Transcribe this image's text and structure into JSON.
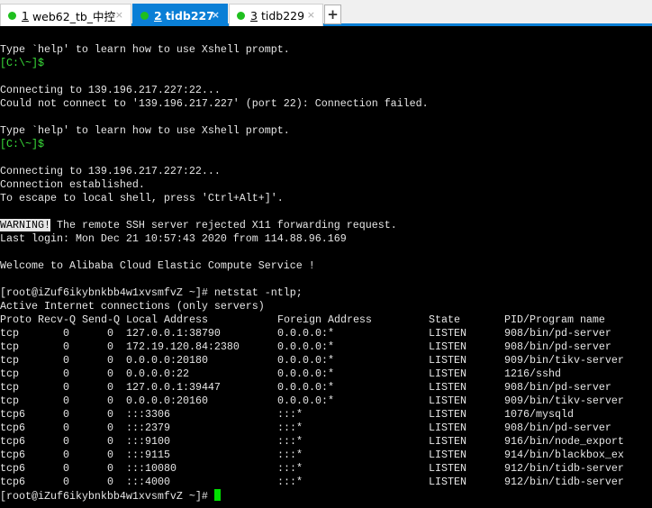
{
  "tabs": [
    {
      "num": "1",
      "label": "web62_tb_中控",
      "close": "×"
    },
    {
      "num": "2",
      "label": "tidb227",
      "close": "×"
    },
    {
      "num": "3",
      "label": "tidb229",
      "close": "×"
    }
  ],
  "new_tab": "+",
  "terminal": {
    "help1": "Type `help' to learn how to use Xshell prompt.",
    "local_prompt": "[C:\\~]$",
    "connecting": "Connecting to 139.196.217.227:22...",
    "failed": "Could not connect to '139.196.217.227' (port 22): Connection failed.",
    "help2": "Type `help' to learn how to use Xshell prompt.",
    "local_prompt2": "[C:\\~]$",
    "connecting2": "Connecting to 139.196.217.227:22...",
    "established": "Connection established.",
    "escape": "To escape to local shell, press 'Ctrl+Alt+]'.",
    "warning_tag": "WARNING!",
    "warning_text": " The remote SSH server rejected X11 forwarding request.",
    "last_login": "Last login: Mon Dec 21 10:57:43 2020 from 114.88.96.169",
    "welcome": "Welcome to Alibaba Cloud Elastic Compute Service !",
    "command": "[root@iZuf6ikybnkbb4w1xvsmfvZ ~]# netstat -ntlp;",
    "active": "Active Internet connections (only servers)",
    "headers": [
      "Proto",
      "Recv-Q",
      "Send-Q",
      "Local Address",
      "Foreign Address",
      "State",
      "PID/Program name"
    ],
    "rows": [
      [
        "tcp",
        "0",
        "0",
        "127.0.0.1:38790",
        "0.0.0.0:*",
        "LISTEN",
        "908/bin/pd-server"
      ],
      [
        "tcp",
        "0",
        "0",
        "172.19.120.84:2380",
        "0.0.0.0:*",
        "LISTEN",
        "908/bin/pd-server"
      ],
      [
        "tcp",
        "0",
        "0",
        "0.0.0.0:20180",
        "0.0.0.0:*",
        "LISTEN",
        "909/bin/tikv-server"
      ],
      [
        "tcp",
        "0",
        "0",
        "0.0.0.0:22",
        "0.0.0.0:*",
        "LISTEN",
        "1216/sshd"
      ],
      [
        "tcp",
        "0",
        "0",
        "127.0.0.1:39447",
        "0.0.0.0:*",
        "LISTEN",
        "908/bin/pd-server"
      ],
      [
        "tcp",
        "0",
        "0",
        "0.0.0.0:20160",
        "0.0.0.0:*",
        "LISTEN",
        "909/bin/tikv-server"
      ],
      [
        "tcp6",
        "0",
        "0",
        ":::3306",
        ":::*",
        "LISTEN",
        "1076/mysqld"
      ],
      [
        "tcp6",
        "0",
        "0",
        ":::2379",
        ":::*",
        "LISTEN",
        "908/bin/pd-server"
      ],
      [
        "tcp6",
        "0",
        "0",
        ":::9100",
        ":::*",
        "LISTEN",
        "916/bin/node_export"
      ],
      [
        "tcp6",
        "0",
        "0",
        ":::9115",
        ":::*",
        "LISTEN",
        "914/bin/blackbox_ex"
      ],
      [
        "tcp6",
        "0",
        "0",
        ":::10080",
        ":::*",
        "LISTEN",
        "912/bin/tidb-server"
      ],
      [
        "tcp6",
        "0",
        "0",
        ":::4000",
        ":::*",
        "LISTEN",
        "912/bin/tidb-server"
      ]
    ],
    "final_prompt": "[root@iZuf6ikybnkbb4w1xvsmfvZ ~]#"
  }
}
